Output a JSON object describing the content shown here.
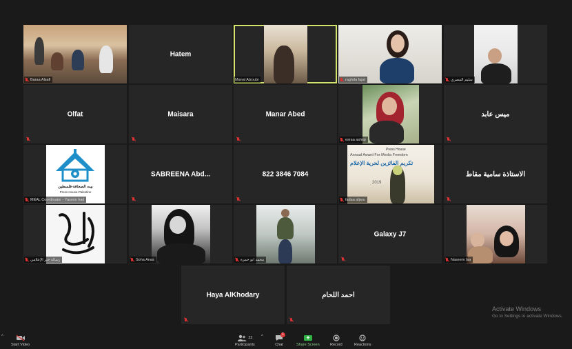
{
  "tiles": {
    "t1": {
      "name": "Baraa Alsafi",
      "kind": "video"
    },
    "t2": {
      "name": "Hatem",
      "kind": "name"
    },
    "t3": {
      "name": "Manal Alzoubi",
      "kind": "video",
      "active": true
    },
    "t4": {
      "name": "raghda fajal",
      "kind": "video"
    },
    "t5": {
      "name": "سليم المصري",
      "kind": "video"
    },
    "t6": {
      "name": "Olfat",
      "kind": "name"
    },
    "t7": {
      "name": "Maisara",
      "kind": "name"
    },
    "t8": {
      "name": "Manar Abed",
      "kind": "name"
    },
    "t9": {
      "name": "esraa ashiqr",
      "kind": "video"
    },
    "t10": {
      "name": "ميس عابد",
      "kind": "name"
    },
    "t11": {
      "name": "MEAL Coordinator - Yasmin had",
      "kind": "video",
      "logo_text": "بيت الصحافة-فلسطين",
      "logo_sub": "Press House-Palestine"
    },
    "t12": {
      "name": "SABREENA  Abd...",
      "kind": "name"
    },
    "t13": {
      "name": "822 3846 7084",
      "kind": "name"
    },
    "t14": {
      "name": "fadaa aljaru",
      "kind": "video",
      "banner_en": "Annual Award For Media Freedom",
      "banner_ar": "تكريم الفائزين لحرية الإعلام",
      "banner_year": "2019",
      "banner_top": "Press House"
    },
    "t15": {
      "name": "الاستاذة سامية مقاط",
      "kind": "name"
    },
    "t16": {
      "name": "رسالة خير الإعلامي",
      "kind": "video"
    },
    "t17": {
      "name": "Soha Anas",
      "kind": "video"
    },
    "t18": {
      "name": "محمد ابو حمزة",
      "kind": "video"
    },
    "t19": {
      "name": "Galaxy J7",
      "kind": "name"
    },
    "t20": {
      "name": "Naseem Isa",
      "kind": "video"
    },
    "t21": {
      "name": "Haya AlKhodary",
      "kind": "name"
    },
    "t22": {
      "name": "أحمد اللحام",
      "kind": "name"
    }
  },
  "toolbar": {
    "start_video": "Start Video",
    "participants": "Participants",
    "participants_count": "22",
    "chat": "Chat",
    "chat_badge": "1",
    "share_screen": "Share Screen",
    "record": "Record",
    "reactions": "Reactions"
  },
  "watermark": {
    "title": "Activate Windows",
    "subtitle": "Go to Settings to activate Windows."
  },
  "colors": {
    "background": "#1a1a1a",
    "tile": "#262626",
    "active_border": "#d4e36b",
    "muted_mic": "#dd3333",
    "share_green": "#2fb344"
  },
  "icons": {
    "video": "video-off-icon",
    "participants": "participants-icon",
    "chat": "chat-icon",
    "share": "share-screen-icon",
    "record": "record-icon",
    "reactions": "reactions-icon"
  }
}
